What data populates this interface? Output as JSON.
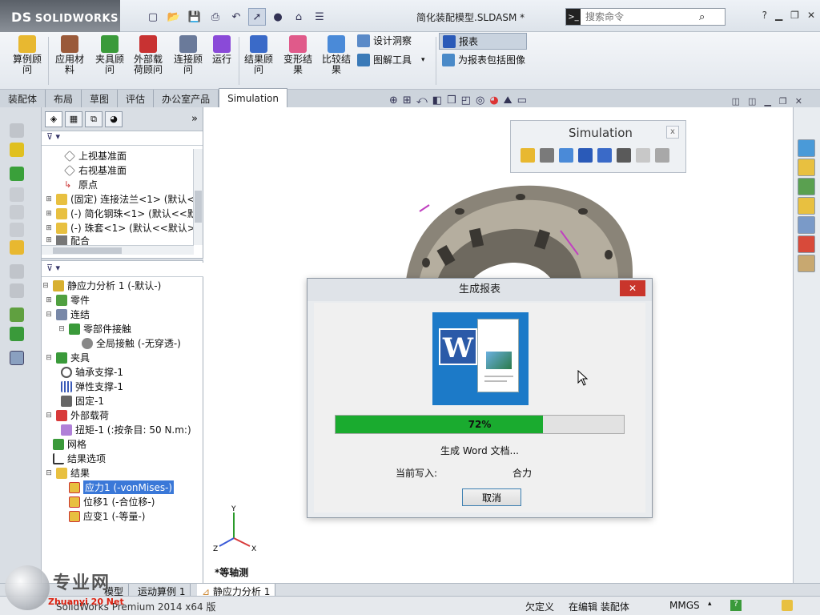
{
  "app": {
    "logo_text": "SOLIDWORKS",
    "logo_mark": "DS"
  },
  "titlebar": {
    "document_title": "简化装配模型.SLDASM *",
    "search_placeholder": "搜索命令"
  },
  "ribbon": {
    "buttons": [
      {
        "label": "算例顾\n问"
      },
      {
        "label": "应用材\n料"
      },
      {
        "label": "夹具顾\n问"
      },
      {
        "label": "外部载\n荷顾问"
      },
      {
        "label": "连接顾\n问"
      },
      {
        "label": "运行"
      },
      {
        "label": "结果顾\n问"
      },
      {
        "label": "变形结\n果"
      },
      {
        "label": "比较结\n果"
      }
    ],
    "small": {
      "design_insight": "设计洞察",
      "plot_tools": "图解工具",
      "report": "报表",
      "include_images": "为报表包括图像"
    }
  },
  "command_tabs": [
    {
      "label": "装配体"
    },
    {
      "label": "布局"
    },
    {
      "label": "草图"
    },
    {
      "label": "评估"
    },
    {
      "label": "办公室产品"
    },
    {
      "label": "Simulation"
    }
  ],
  "feature_tree": {
    "top_items": [
      {
        "label": "上视基准面"
      },
      {
        "label": "右视基准面"
      },
      {
        "label": "原点"
      },
      {
        "label": "(固定) 连接法兰<1> (默认<"
      },
      {
        "label": "(-) 简化钢珠<1> (默认<<默"
      },
      {
        "label": "(-) 珠套<1> (默认<<默认>_"
      },
      {
        "label": "配合"
      }
    ],
    "study_items": [
      {
        "label": "静应力分析 1 (-默认-)"
      },
      {
        "label": "零件"
      },
      {
        "label": "连结"
      },
      {
        "label": "零部件接触"
      },
      {
        "label": "全局接触 (-无穿透-)"
      },
      {
        "label": "夹具"
      },
      {
        "label": "轴承支撑-1"
      },
      {
        "label": "弹性支撑-1"
      },
      {
        "label": "固定-1"
      },
      {
        "label": "外部载荷"
      },
      {
        "label": "扭矩-1 (:按条目: 50 N.m:)"
      },
      {
        "label": "网格"
      },
      {
        "label": "结果选项"
      },
      {
        "label": "结果"
      },
      {
        "label": "应力1 (-vonMises-)"
      },
      {
        "label": "位移1 (-合位移-)"
      },
      {
        "label": "应变1 (-等量-)"
      }
    ]
  },
  "simulation_toolbar": {
    "title": "Simulation",
    "close": "x"
  },
  "graphics": {
    "view_label": "*等轴测",
    "triad": {
      "x": "X",
      "y": "Y",
      "z": "Z"
    }
  },
  "dialog": {
    "title": "生成报表",
    "close": "✕",
    "progress_percent": 72,
    "progress_text": "72%",
    "status_text": "生成 Word 文档...",
    "writing_label": "当前写入:",
    "writing_value": "合力",
    "cancel": "取消"
  },
  "bottom_tabs": [
    {
      "label": "模型"
    },
    {
      "label": "运动算例 1"
    },
    {
      "label": "静应力分析 1"
    }
  ],
  "statusbar": {
    "version": "SolidWorks Premium 2014 x64 版",
    "underdefined": "欠定义",
    "editing": "在编辑 装配体",
    "units": "MMGS"
  },
  "watermark": {
    "text": "专业网",
    "sub": "Zhuanyi 20 Net"
  },
  "colors": {
    "progress": "#1aab2f",
    "accent": "#3a78d8",
    "close_red": "#c9352b"
  }
}
